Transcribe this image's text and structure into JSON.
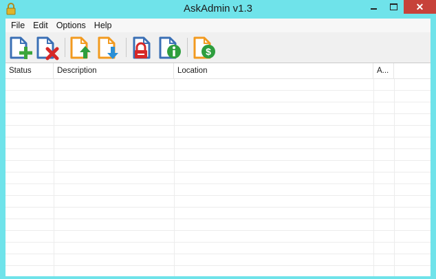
{
  "window": {
    "title": "AskAdmin v1.3",
    "close_glyph": "✕"
  },
  "menu": {
    "items": [
      "File",
      "Edit",
      "Options",
      "Help"
    ]
  },
  "toolbar": {
    "buttons": [
      {
        "name": "add-icon",
        "colors": {
          "doc": "#3a6fb5",
          "badge": "#3aa53a"
        }
      },
      {
        "name": "remove-icon",
        "colors": {
          "doc": "#3a6fb5",
          "badge": "#d62828"
        }
      },
      {
        "name": "export-icon",
        "colors": {
          "doc": "#f29a1f",
          "badge": "#2e9e3e"
        }
      },
      {
        "name": "import-icon",
        "colors": {
          "doc": "#f29a1f",
          "badge": "#2a8fd6"
        }
      },
      {
        "name": "lock-icon",
        "colors": {
          "doc": "#3a6fb5",
          "badge": "#d62828"
        }
      },
      {
        "name": "info-icon",
        "colors": {
          "doc": "#3a6fb5",
          "badge": "#2e9e3e"
        }
      },
      {
        "name": "donate-icon",
        "colors": {
          "doc": "#f29a1f",
          "badge": "#2e9e3e"
        }
      }
    ]
  },
  "grid": {
    "columns": [
      "Status",
      "Description",
      "Location",
      "A..."
    ]
  }
}
